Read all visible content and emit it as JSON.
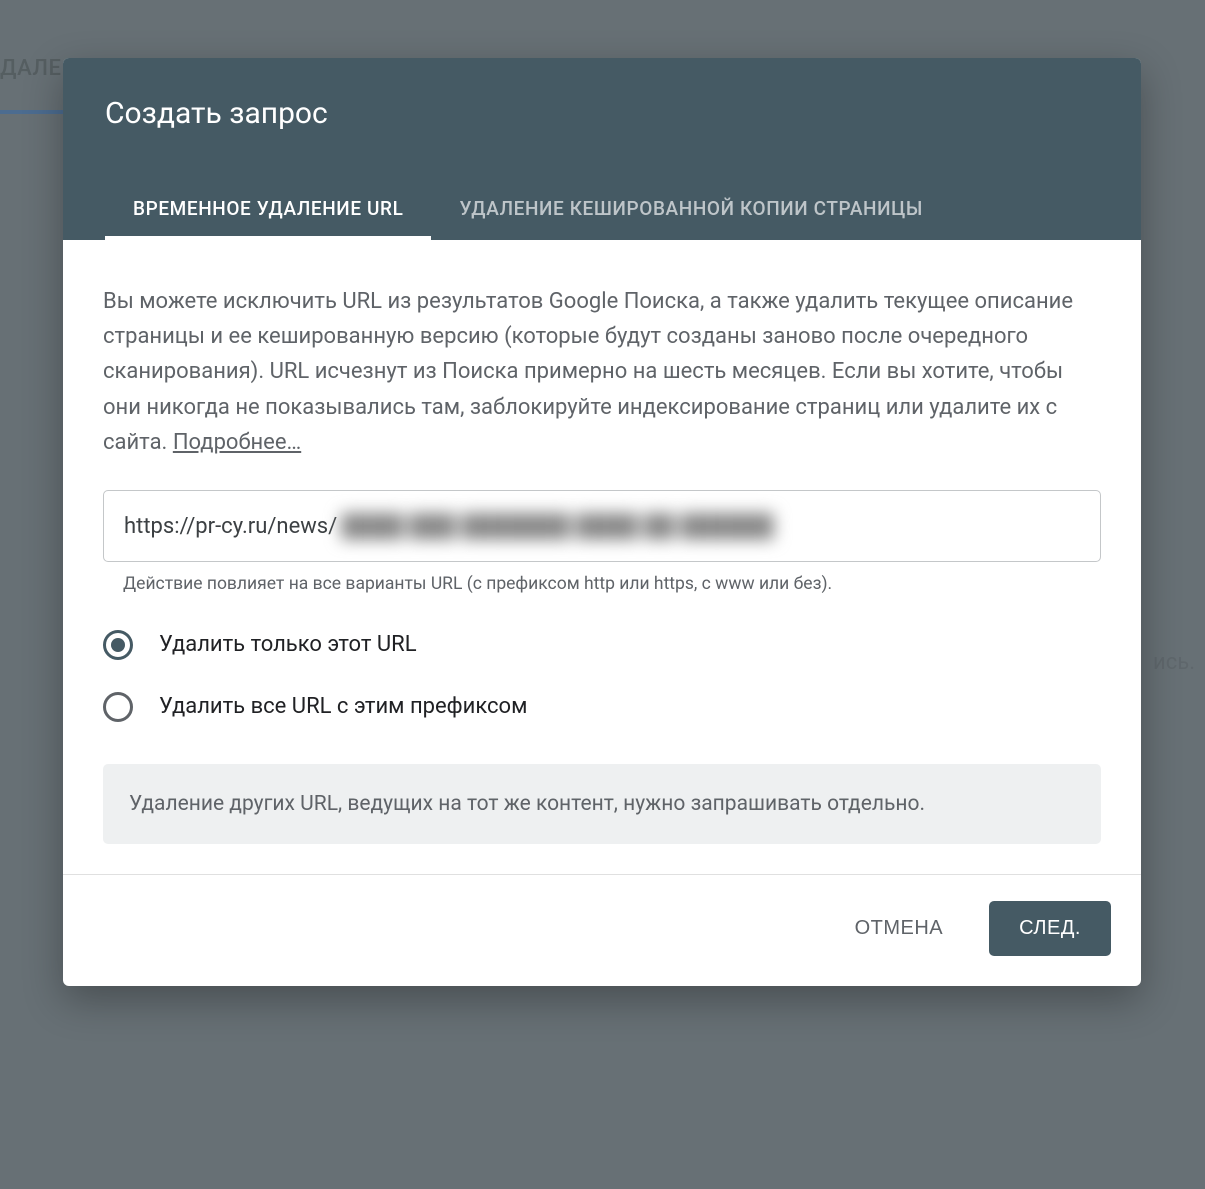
{
  "background": {
    "tab_fragment": "ДАЛЕ",
    "right_text_fragment": "ись."
  },
  "dialog": {
    "title": "Создать запрос",
    "tabs": [
      {
        "label": "ВРЕМЕННОЕ УДАЛЕНИЕ URL",
        "active": true
      },
      {
        "label": "УДАЛЕНИЕ КЕШИРОВАННОЙ КОПИИ СТРАНИЦЫ",
        "active": false
      }
    ],
    "description_text": "Вы можете исключить URL из результатов Google Поиска, а также удалить текущее описание страницы и ее кешированную версию (которые будут созданы заново после очередного сканирования). URL исчезнут из Поиска примерно на шесть месяцев. Если вы хотите, чтобы они никогда не показывались там, заблокируйте индексирование страниц или удалите их с сайта. ",
    "learn_more_label": "Подробнее…",
    "url_input": {
      "visible_value": "https://pr-cy.ru/news/",
      "redacted_placeholder": "████ ███ ███████ ████ ██ ██████"
    },
    "hint": "Действие повлияет на все варианты URL (с префиксом http или https, с www или без).",
    "radios": [
      {
        "label": "Удалить только этот URL",
        "checked": true
      },
      {
        "label": "Удалить все URL с этим префиксом",
        "checked": false
      }
    ],
    "info_note": "Удаление других URL, ведущих на тот же контент, нужно запрашивать отдельно.",
    "buttons": {
      "cancel": "ОТМЕНА",
      "next": "СЛЕД."
    }
  }
}
